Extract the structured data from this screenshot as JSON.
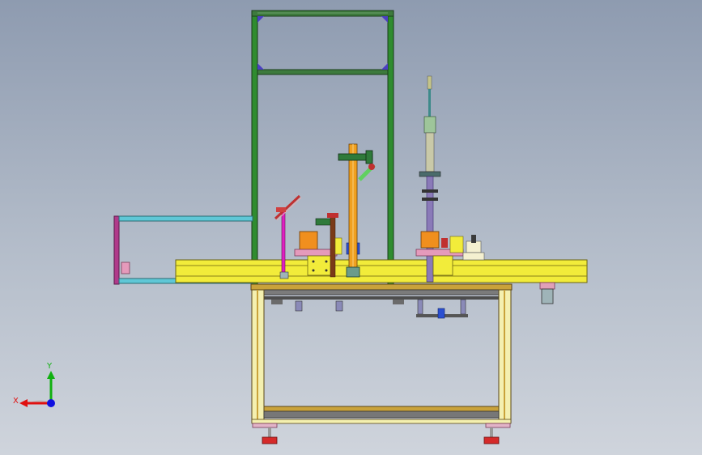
{
  "triad": {
    "x_label": "X",
    "y_label": "Y"
  },
  "colors": {
    "background_top": "#8e9bb0",
    "background_bottom": "#cfd4dc",
    "frame_green": "#2f8c2f",
    "table_yellow": "#f2ec3a",
    "axis_x": "#e01010",
    "axis_y": "#10b010",
    "axis_z": "#1010e0"
  }
}
